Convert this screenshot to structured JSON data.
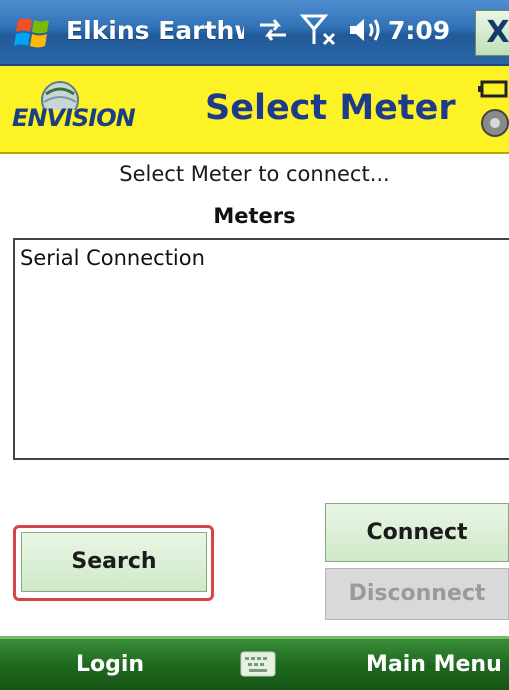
{
  "titlebar": {
    "app_title": "Elkins Earthworl",
    "time": "7:09",
    "close_label": "X"
  },
  "header": {
    "logo_text": "ENVISION",
    "title": "Select Meter"
  },
  "main": {
    "prompt": "Select Meter to connect...",
    "list_label": "Meters",
    "list_items": [
      "Serial Connection"
    ]
  },
  "buttons": {
    "search": "Search",
    "connect": "Connect",
    "disconnect": "Disconnect"
  },
  "menubar": {
    "left": "Login",
    "right": "Main Menu"
  },
  "colors": {
    "header_bg": "#fdf225",
    "title_color": "#1e3a8a",
    "menubar_bg": "#1f6a1f",
    "button_bg": "#d8efd2",
    "highlight": "#d64545"
  }
}
